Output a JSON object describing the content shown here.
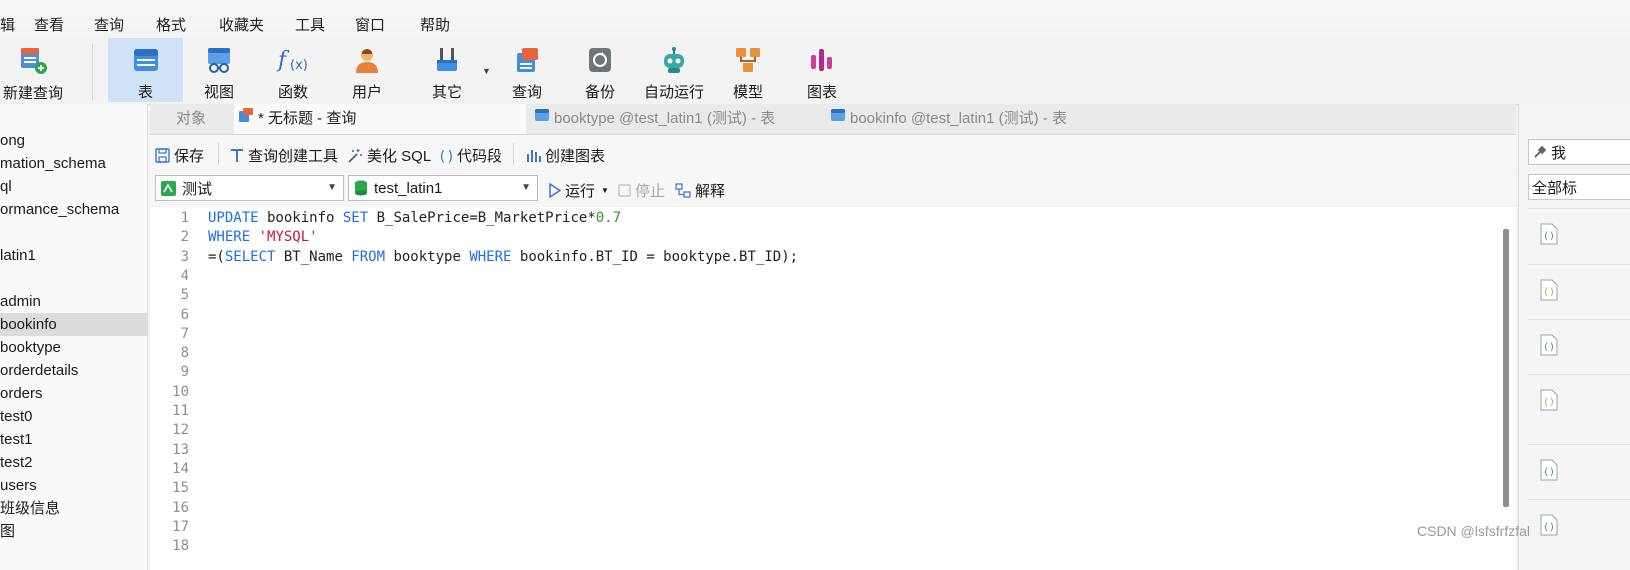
{
  "menu": [
    "辑",
    "查看",
    "查询",
    "格式",
    "收藏夹",
    "工具",
    "窗口",
    "帮助"
  ],
  "toolbar": {
    "items": [
      {
        "label": "新建查询",
        "icon": "new-query-icon"
      },
      {
        "label": "表",
        "icon": "table-icon",
        "active": true
      },
      {
        "label": "视图",
        "icon": "view-icon"
      },
      {
        "label": "函数",
        "icon": "function-icon"
      },
      {
        "label": "用户",
        "icon": "user-icon"
      },
      {
        "label": "其它",
        "icon": "tools-icon"
      },
      {
        "label": "查询",
        "icon": "query-icon"
      },
      {
        "label": "备份",
        "icon": "backup-icon"
      },
      {
        "label": "自动运行",
        "icon": "robot-icon"
      },
      {
        "label": "模型",
        "icon": "model-icon"
      },
      {
        "label": "图表",
        "icon": "chart-icon"
      }
    ]
  },
  "sidebar": {
    "items": [
      {
        "label": "ong"
      },
      {
        "label": "mation_schema"
      },
      {
        "label": "ql"
      },
      {
        "label": "ormance_schema"
      },
      {
        "label": ""
      },
      {
        "label": "latin1"
      },
      {
        "label": ""
      },
      {
        "label": "admin"
      },
      {
        "label": "bookinfo",
        "selected": true
      },
      {
        "label": "booktype"
      },
      {
        "label": "orderdetails"
      },
      {
        "label": "orders"
      },
      {
        "label": "test0"
      },
      {
        "label": "test1"
      },
      {
        "label": "test2"
      },
      {
        "label": "users"
      },
      {
        "label": "班级信息"
      },
      {
        "label": "图"
      }
    ]
  },
  "tabs": [
    {
      "label": "对象"
    },
    {
      "label": "* 无标题 - 查询",
      "active": true
    },
    {
      "label": "booktype @test_latin1 (测试) - 表"
    },
    {
      "label": "bookinfo @test_latin1 (测试) - 表"
    }
  ],
  "editor_toolbar": {
    "save": "保存",
    "query_builder": "查询创建工具",
    "beautify": "美化 SQL",
    "snippet": "代码段",
    "create_chart": "创建图表"
  },
  "connection": {
    "connection_name": "测试",
    "database": "test_latin1",
    "run": "运行",
    "stop": "停止",
    "explain": "解释"
  },
  "editor": {
    "line_numbers": [
      "1",
      "2",
      "3",
      "4",
      "5",
      "6",
      "7",
      "8",
      "9",
      "10",
      "11",
      "12",
      "13",
      "14",
      "15",
      "16",
      "17",
      "18"
    ],
    "lines": [
      [
        {
          "t": "UPDATE",
          "c": "kw"
        },
        {
          "t": " bookinfo "
        },
        {
          "t": "SET",
          "c": "kw"
        },
        {
          "t": " B_SalePrice=B_MarketPrice*"
        },
        {
          "t": "0.7",
          "c": "num"
        }
      ],
      [
        {
          "t": "WHERE",
          "c": "kw"
        },
        {
          "t": " "
        },
        {
          "t": "'MYSQL'",
          "c": "str"
        }
      ],
      [
        {
          "t": "=("
        },
        {
          "t": "SELECT",
          "c": "kw"
        },
        {
          "t": " BT_Name "
        },
        {
          "t": "FROM",
          "c": "kw"
        },
        {
          "t": " booktype "
        },
        {
          "t": "WHERE",
          "c": "kw"
        },
        {
          "t": " bookinfo.BT_ID = booktype.BT_ID);"
        }
      ]
    ]
  },
  "right_panel": {
    "search_label": "我",
    "filter_label": "全部标"
  },
  "watermark": "CSDN @lsfsfrfzfal",
  "colors": {
    "keyword": "#1f6fe0",
    "string": "#d0144a",
    "number": "#2a9a2a",
    "active_tool": "#cfe3f7",
    "selected_row": "#dcdcdc"
  }
}
